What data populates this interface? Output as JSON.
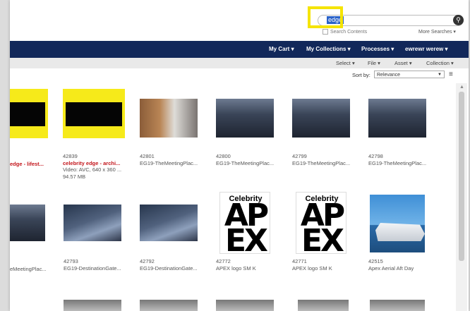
{
  "search": {
    "value": "edge",
    "button_icon": "search-icon",
    "within_label": "Search Contents",
    "more_label": "More Searches"
  },
  "nav": {
    "items": [
      {
        "label": "My Cart"
      },
      {
        "label": "My Collections"
      },
      {
        "label": "Processes"
      },
      {
        "label": "ewrewr werew"
      }
    ]
  },
  "toolbar": {
    "items": [
      {
        "label": "Select"
      },
      {
        "label": "File"
      },
      {
        "label": "Asset"
      },
      {
        "label": "Collection"
      }
    ]
  },
  "sort": {
    "label": "Sort by:",
    "value": "Relevance"
  },
  "assets": [
    {
      "id": "",
      "title": "edge - lifest...",
      "detail": "",
      "title_red": true
    },
    {
      "id": "42839",
      "title": "celebrity edge - archi...",
      "detail": "Video: AVC, 640 x 360 ...",
      "detail2": "94.57 MB",
      "title_red": true
    },
    {
      "id": "42801",
      "title": "EG19-TheMeetingPlac...",
      "detail": ""
    },
    {
      "id": "42800",
      "title": "EG19-TheMeetingPlac...",
      "detail": ""
    },
    {
      "id": "42799",
      "title": "EG19-TheMeetingPlac...",
      "detail": ""
    },
    {
      "id": "42798",
      "title": "EG19-TheMeetingPlac...",
      "detail": ""
    },
    {
      "id": "",
      "title": "eMeetingPlac...",
      "detail": ""
    },
    {
      "id": "42793",
      "title": "EG19-DestinationGate...",
      "detail": ""
    },
    {
      "id": "42792",
      "title": "EG19-DestinationGate...",
      "detail": ""
    },
    {
      "id": "42772",
      "title": "APEX logo SM K",
      "detail": ""
    },
    {
      "id": "42771",
      "title": "APEX logo SM K",
      "detail": ""
    },
    {
      "id": "42515",
      "title": "Apex Aerial Aft Day",
      "detail": ""
    }
  ],
  "apex_logo": {
    "top": "Celebrity",
    "line1": "AP",
    "line2": "EX"
  }
}
